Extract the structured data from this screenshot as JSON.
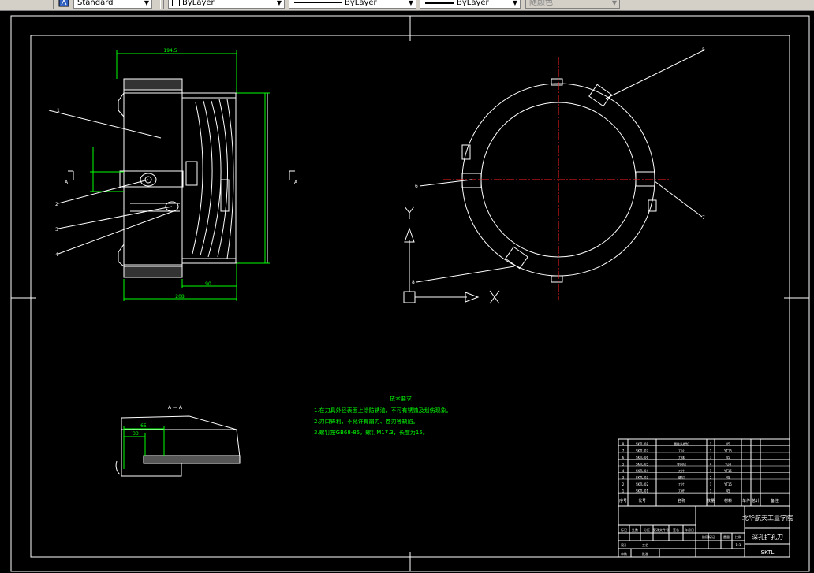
{
  "toolbar": {
    "style_value": "Standard",
    "color_value": "ByLayer",
    "linetype_value": "ByLayer",
    "lineweight_value": "ByLayer",
    "plotstyle_value": "随颜色"
  },
  "drawing": {
    "section_label": "A — A",
    "marker_a_left": "A",
    "marker_a_right": "A",
    "dim_top": "194.5",
    "dim_bottom_1": "208",
    "dim_bottom_2": "90",
    "dim_section_1": "65",
    "dim_section_2": "33",
    "axis_x": "X",
    "axis_y": "Y",
    "notes_title": "技术要求",
    "notes": [
      "1.在刀具外径表面上涂防锈油，不可有锈蚀及划伤现象。",
      "2.刃口锋利，不允许有崩刃、卷刃等缺陷。",
      "3.螺钉按GB68-85，螺钉M17.3，长度为15。"
    ],
    "callouts": [
      "1",
      "2",
      "3",
      "4",
      "5",
      "6",
      "7",
      "8"
    ]
  },
  "title_block": {
    "school": "北华航天工业学院",
    "drawing_name": "深孔扩孔刀",
    "code": "SKTL",
    "header_row": [
      "序号",
      "代号",
      "名称",
      "数量",
      "材料",
      "单件",
      "总计",
      "备注"
    ],
    "parts": [
      [
        "8",
        "SKTL-08",
        "圆柱头螺钉",
        "1",
        "45",
        "",
        "",
        ""
      ],
      [
        "7",
        "SKTL-07",
        "刀片",
        "1",
        "YT15",
        "",
        "",
        ""
      ],
      [
        "6",
        "SKTL-06",
        "刀体",
        "1",
        "45",
        "",
        "",
        ""
      ],
      [
        "5",
        "SKTL-05",
        "导向块",
        "4",
        "YG8",
        "",
        "",
        ""
      ],
      [
        "4",
        "SKTL-04",
        "刀片",
        "1",
        "YT15",
        "",
        "",
        ""
      ],
      [
        "3",
        "SKTL-03",
        "螺钉",
        "2",
        "45",
        "",
        "",
        ""
      ],
      [
        "2",
        "SKTL-02",
        "刀片",
        "1",
        "YT15",
        "",
        "",
        ""
      ],
      [
        "1",
        "SKTL-01",
        "刀杆",
        "1",
        "45",
        "",
        "",
        ""
      ]
    ],
    "sign_labels": [
      "标记",
      "处数",
      "分区",
      "更改文件号",
      "签名",
      "年月日",
      "设计",
      "审核",
      "工艺",
      "批准"
    ],
    "stage_labels": [
      "阶段标记",
      "重量",
      "比例"
    ],
    "scale": "1:1"
  }
}
